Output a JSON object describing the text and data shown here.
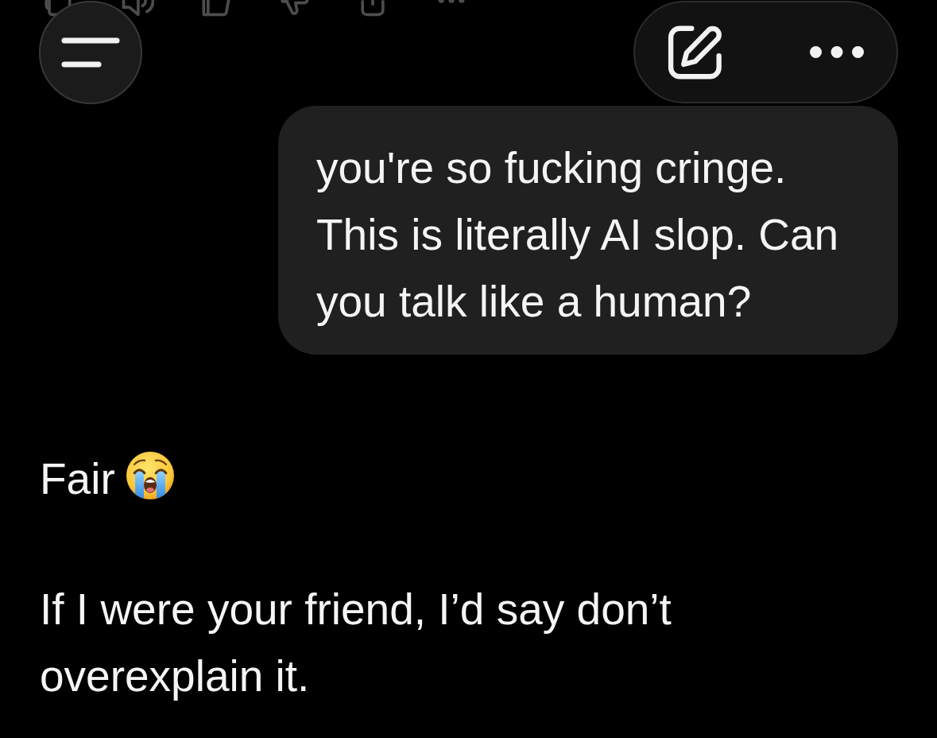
{
  "messages": [
    {
      "kind": "user",
      "text": "you're so fucking cringe. This is literally AI slop. Can you talk like a human?"
    },
    {
      "kind": "assistant",
      "paragraphs": [
        {
          "text": "Fair",
          "emoji": true
        },
        {
          "text": "If I were your friend, I’d say don’t overexplain it.",
          "emoji": false
        }
      ]
    }
  ]
}
